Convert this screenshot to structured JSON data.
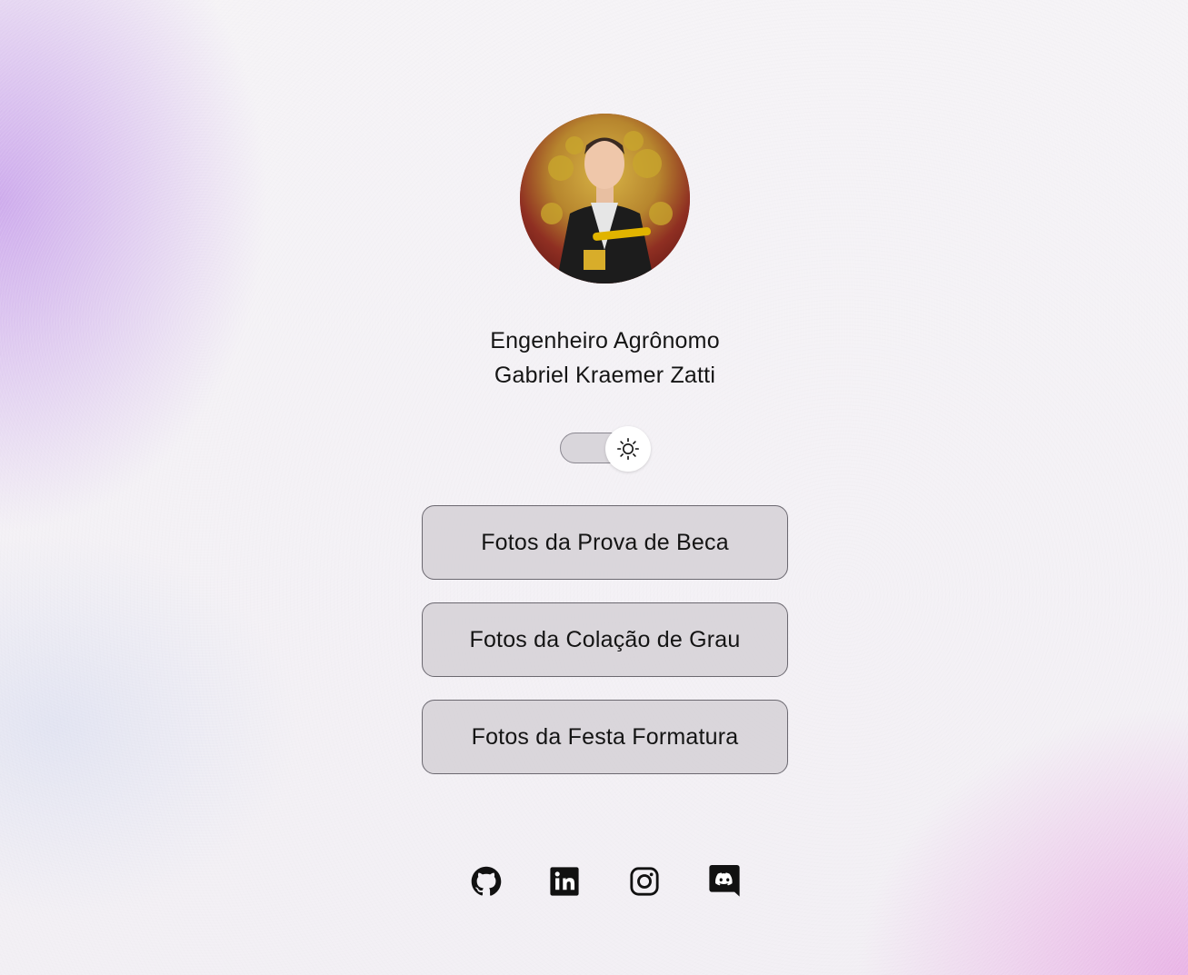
{
  "profile": {
    "line1": "Engenheiro Agrônomo",
    "line2": "Gabriel Kraemer Zatti",
    "avatar_icon": "profile-photo"
  },
  "theme_toggle": {
    "icon": "sun-icon",
    "state": "light"
  },
  "buttons": [
    {
      "label": "Fotos da Prova de Beca"
    },
    {
      "label": "Fotos da Colação de Grau"
    },
    {
      "label": "Fotos da Festa Formatura"
    }
  ],
  "social": [
    {
      "icon": "github-icon"
    },
    {
      "icon": "linkedin-icon"
    },
    {
      "icon": "instagram-icon"
    },
    {
      "icon": "discord-icon"
    }
  ],
  "colors": {
    "text": "#111111",
    "button_bg": "#d2ced4",
    "button_border": "#6b6870",
    "accent_left": "#c8a0eb",
    "accent_right": "#e6a0e1"
  }
}
